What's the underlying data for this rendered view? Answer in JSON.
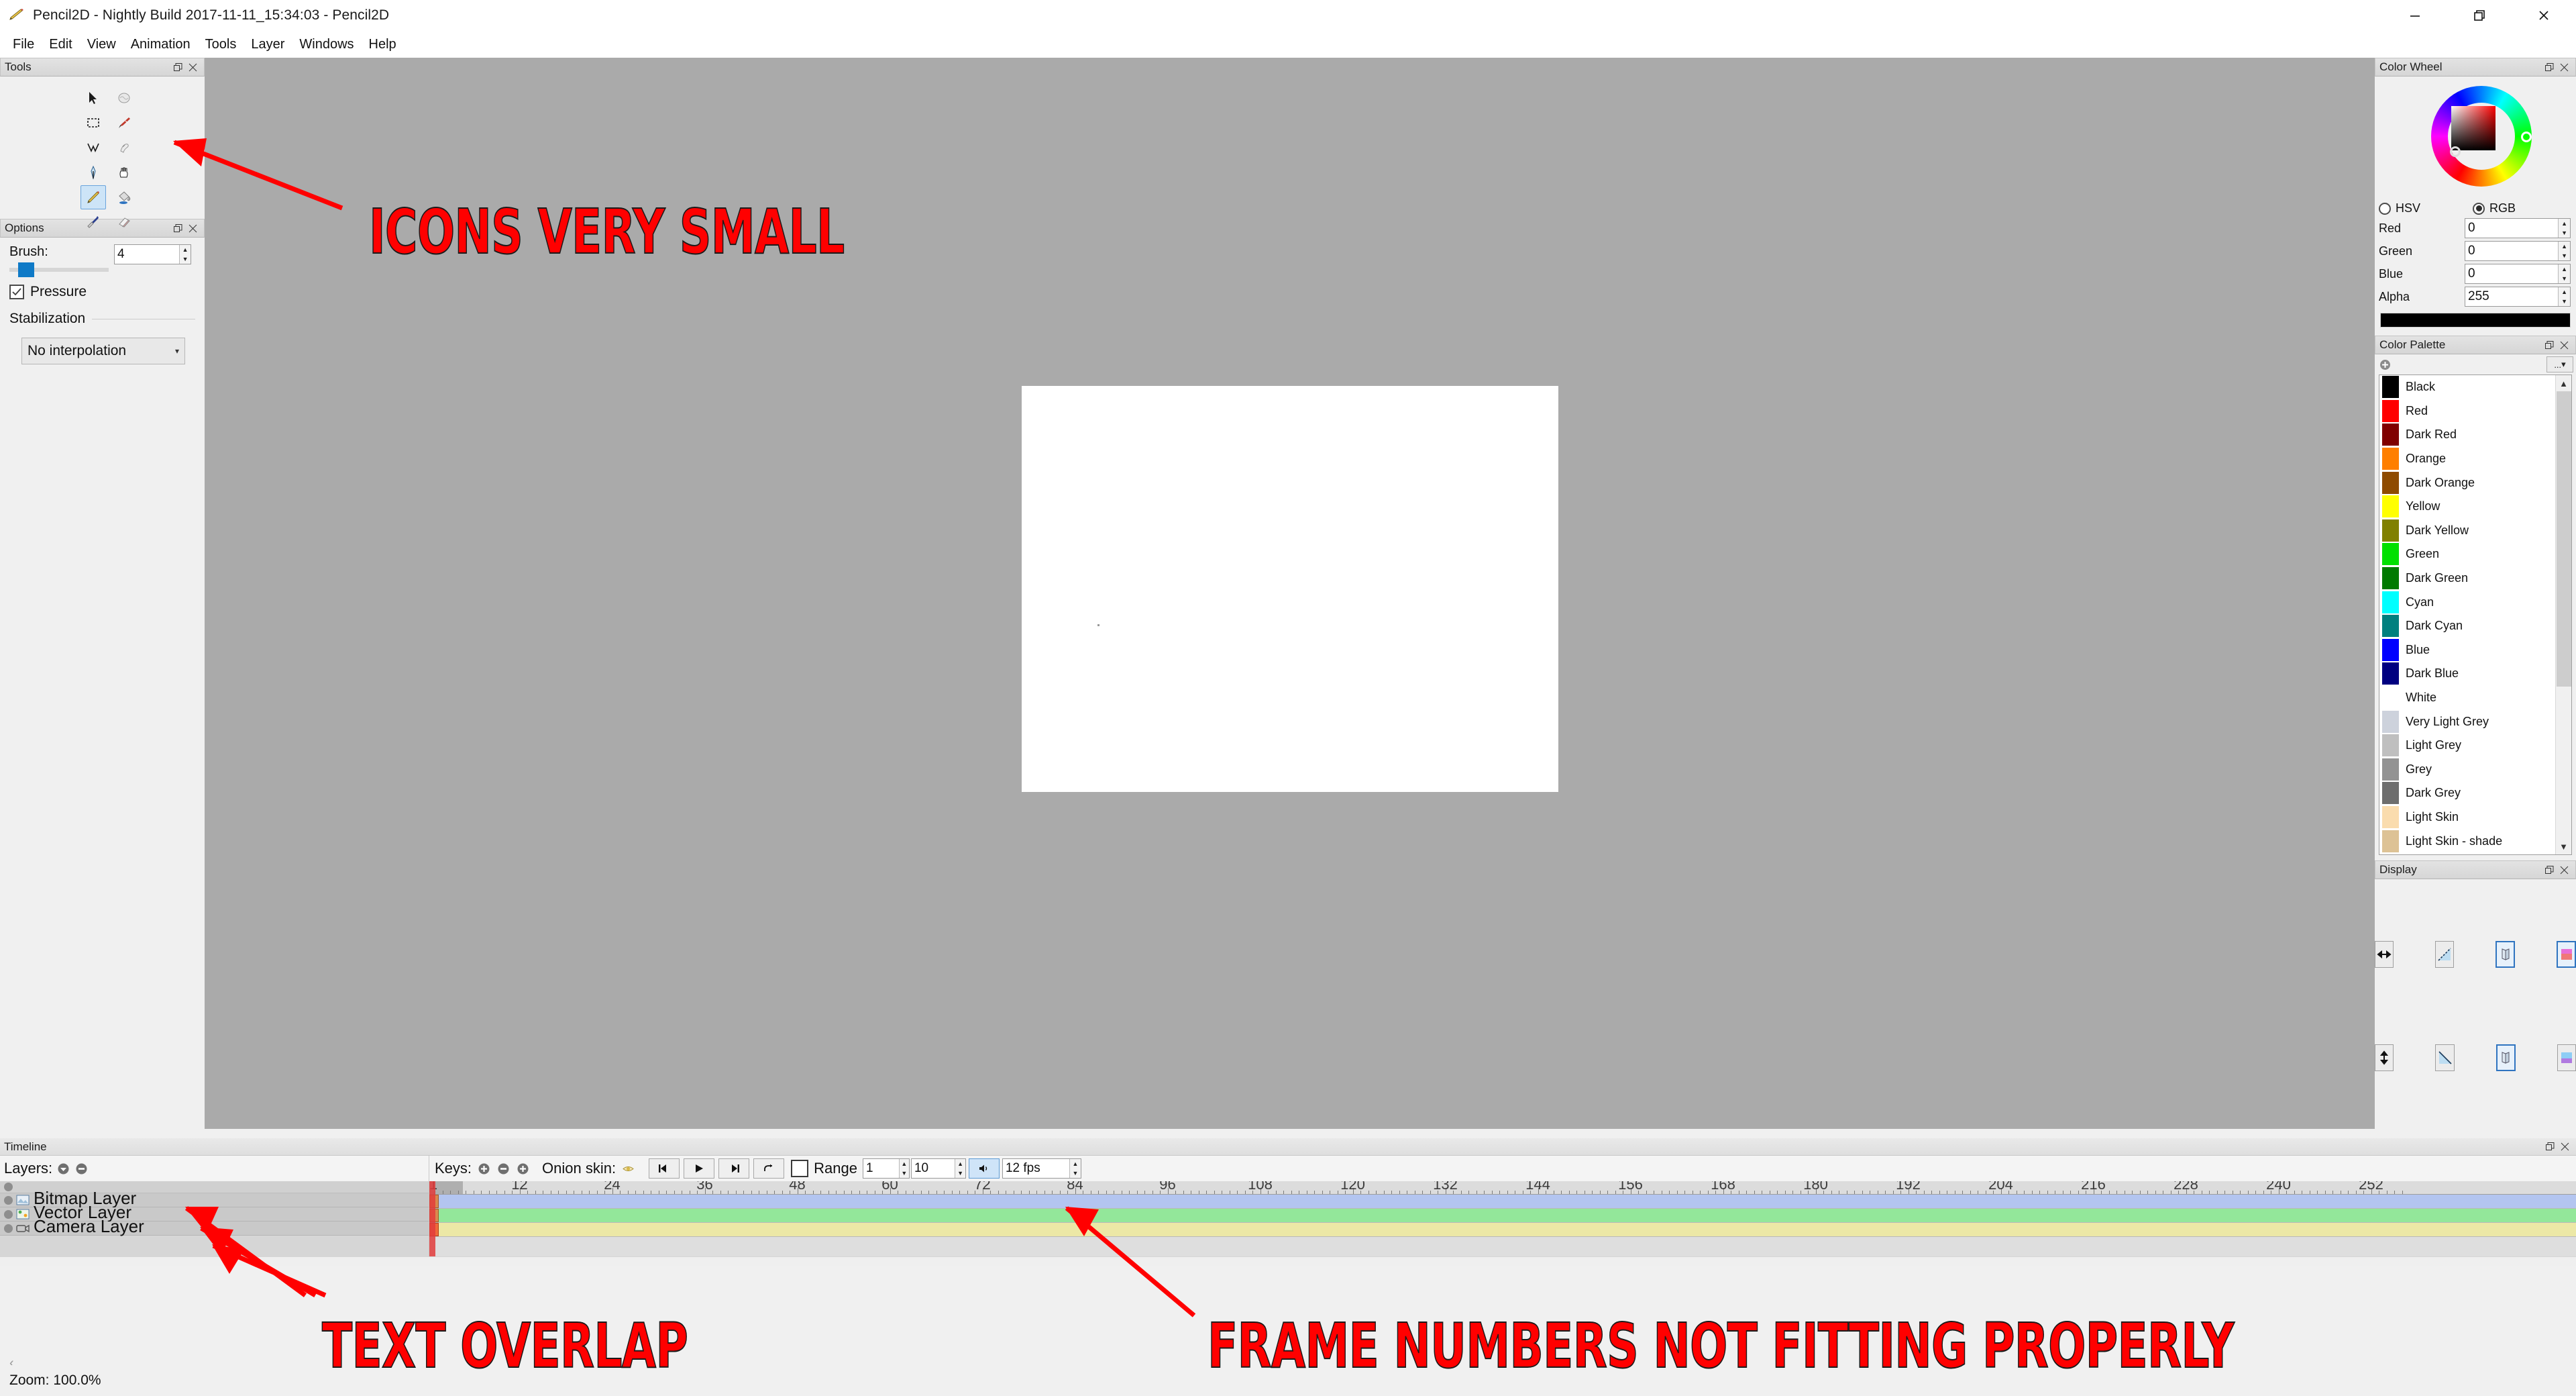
{
  "window": {
    "title": "Pencil2D - Nightly Build 2017-11-11_15:34:03 - Pencil2D",
    "app_icon": "pencil-icon",
    "controls": {
      "minimize": "minimize-icon",
      "restore": "restore-icon",
      "close": "close-icon"
    }
  },
  "menubar": {
    "items": [
      "File",
      "Edit",
      "View",
      "Animation",
      "Tools",
      "Layer",
      "Windows",
      "Help"
    ]
  },
  "tools_panel": {
    "title": "Tools",
    "selected": "pencil",
    "tools": [
      {
        "name": "move-tool",
        "icon": "cursor-arrow-icon"
      },
      {
        "name": "smudge-tool",
        "icon": "smudge-icon"
      },
      {
        "name": "select-tool",
        "icon": "marquee-select-icon"
      },
      {
        "name": "brush-tool",
        "icon": "paintbrush-icon"
      },
      {
        "name": "polyline-tool",
        "icon": "polyline-icon"
      },
      {
        "name": "hand-smudge-tool",
        "icon": "finger-smudge-icon"
      },
      {
        "name": "pen-tool",
        "icon": "pen-nib-icon"
      },
      {
        "name": "hand-tool",
        "icon": "hand-icon"
      },
      {
        "name": "pencil-tool",
        "icon": "pencil-icon"
      },
      {
        "name": "bucket-tool",
        "icon": "paint-bucket-icon"
      },
      {
        "name": "eyedropper-tool",
        "icon": "eyedropper-icon"
      },
      {
        "name": "eraser-tool",
        "icon": "eraser-icon"
      }
    ]
  },
  "options_panel": {
    "title": "Options",
    "brush_label": "Brush:",
    "brush_value": "4",
    "pressure_label": "Pressure",
    "pressure_checked": true,
    "stabilization_label": "Stabilization",
    "interpolation_value": "No interpolation"
  },
  "color_wheel_panel": {
    "title": "Color Wheel",
    "mode_hsv": "HSV",
    "mode_rgb": "RGB",
    "selected_mode": "RGB",
    "channels": [
      {
        "label": "Red",
        "value": "0"
      },
      {
        "label": "Green",
        "value": "0"
      },
      {
        "label": "Blue",
        "value": "0"
      },
      {
        "label": "Alpha",
        "value": "255"
      }
    ],
    "current_color": "#000000"
  },
  "color_palette_panel": {
    "title": "Color Palette",
    "add_icon": "add-color-icon",
    "menu_label": "...",
    "colors": [
      {
        "name": "Black",
        "hex": "#000000"
      },
      {
        "name": "Red",
        "hex": "#ff0000"
      },
      {
        "name": "Dark Red",
        "hex": "#800000"
      },
      {
        "name": "Orange",
        "hex": "#ff7f00"
      },
      {
        "name": "Dark Orange",
        "hex": "#8f4b00"
      },
      {
        "name": "Yellow",
        "hex": "#ffff00"
      },
      {
        "name": "Dark Yellow",
        "hex": "#808000"
      },
      {
        "name": "Green",
        "hex": "#00e000"
      },
      {
        "name": "Dark Green",
        "hex": "#007a00"
      },
      {
        "name": "Cyan",
        "hex": "#00ffff"
      },
      {
        "name": "Dark Cyan",
        "hex": "#00807f"
      },
      {
        "name": "Blue",
        "hex": "#0000ff"
      },
      {
        "name": "Dark Blue",
        "hex": "#000080"
      },
      {
        "name": "White",
        "hex": "#ffffff"
      },
      {
        "name": "Very Light Grey",
        "hex": "#cdd2dc"
      },
      {
        "name": "Light Grey",
        "hex": "#bfbfbf"
      },
      {
        "name": "Grey",
        "hex": "#939393"
      },
      {
        "name": "Dark Grey",
        "hex": "#6e6e6e"
      },
      {
        "name": "Light Skin",
        "hex": "#fadcae"
      },
      {
        "name": "Light Skin - shade",
        "hex": "#ddc295"
      }
    ]
  },
  "display_panel": {
    "title": "Display",
    "buttons": [
      {
        "name": "flip-horizontal-button",
        "icon": "horizontal-arrows-icon",
        "active": false
      },
      {
        "name": "mirror-diagonal-button",
        "icon": "diagonal-mirror-icon",
        "active": false
      },
      {
        "name": "grid-perspective-button",
        "icon": "perspective-plane-icon",
        "active": true
      },
      {
        "name": "overlay-warm-button",
        "icon": "warm-overlay-icon",
        "active": true
      },
      {
        "name": "flip-vertical-button",
        "icon": "vertical-arrows-icon",
        "active": false
      },
      {
        "name": "mirror-diagonal2-button",
        "icon": "diagonal-mirror2-icon",
        "active": false
      },
      {
        "name": "grid-perspective2-button",
        "icon": "perspective-plane2-icon",
        "active": true
      },
      {
        "name": "overlay-cool-button",
        "icon": "cool-overlay-icon",
        "active": false
      }
    ]
  },
  "timeline": {
    "title": "Timeline",
    "layers_label": "Layers:",
    "add_layer_icon": "add-layer-icon",
    "remove_layer_icon": "remove-layer-icon",
    "keys_label": "Keys:",
    "key_icons": [
      "add-key-icon",
      "remove-key-icon",
      "duplicate-key-icon"
    ],
    "onion_skin_label": "Onion skin:",
    "onion_skin_icon": "onion-eye-icon",
    "playback": {
      "prev_frame": "step-back-icon",
      "play": "play-icon",
      "next_frame": "step-forward-icon",
      "loop": "loop-icon",
      "loop_checkbox": false,
      "range_label": "Range",
      "range_start": "1",
      "range_end": "10",
      "sound_icon": "speaker-icon",
      "sound_active": true,
      "fps_value": "12 fps"
    },
    "layers": [
      {
        "name": "Bitmap Layer",
        "icon": "bitmap-layer-icon",
        "track_color": "#b3c5f0"
      },
      {
        "name": "Vector Layer",
        "icon": "vector-layer-icon",
        "track_color": "#93e79a"
      },
      {
        "name": "Camera Layer",
        "icon": "camera-layer-icon",
        "track_color": "#ece8a6"
      }
    ],
    "ruler_numbers": [
      12,
      24,
      36,
      48,
      60,
      72,
      84,
      96,
      108,
      120,
      132,
      144,
      156,
      168,
      180,
      192,
      204,
      216,
      228,
      240,
      252
    ],
    "ruler_start": "1",
    "current_frame": 1
  },
  "statusbar": {
    "zoom_label": "Zoom: 100.0%",
    "back_chevron": "chevron-left-icon"
  },
  "annotations": [
    {
      "name": "annotation-icons-very-small",
      "text": "ICONS VERY SMALL"
    },
    {
      "name": "annotation-text-overlap",
      "text": "TEXT OVERLAP"
    },
    {
      "name": "annotation-frame-numbers",
      "text": "FRAME NUMBERS NOT FITTING PROPERLY"
    }
  ],
  "colors": {
    "canvas_bg": "#aaaaaa",
    "panel_bg": "#f0f0f0",
    "annotation": "#ff0000",
    "accent": "#2f74c0"
  }
}
